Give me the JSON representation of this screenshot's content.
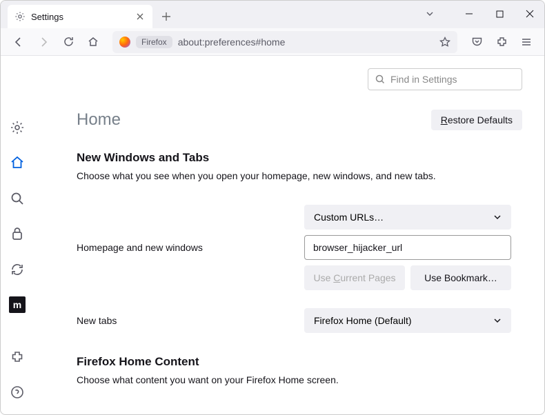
{
  "tab": {
    "title": "Settings"
  },
  "urlbar": {
    "label": "Firefox",
    "url": "about:preferences#home"
  },
  "search": {
    "placeholder": "Find in Settings"
  },
  "page": {
    "title": "Home"
  },
  "buttons": {
    "restore": "Restore Defaults",
    "use_current": "Use Current Pages",
    "use_bookmark": "Use Bookmark…"
  },
  "sections": {
    "windows_tabs": {
      "title": "New Windows and Tabs",
      "desc": "Choose what you see when you open your homepage, new windows, and new tabs."
    },
    "home_content": {
      "title": "Firefox Home Content",
      "desc": "Choose what content you want on your Firefox Home screen."
    }
  },
  "form": {
    "homepage_label": "Homepage and new windows",
    "homepage_select": "Custom URLs…",
    "homepage_value": "browser_hijacker_url",
    "newtabs_label": "New tabs",
    "newtabs_select": "Firefox Home (Default)"
  }
}
